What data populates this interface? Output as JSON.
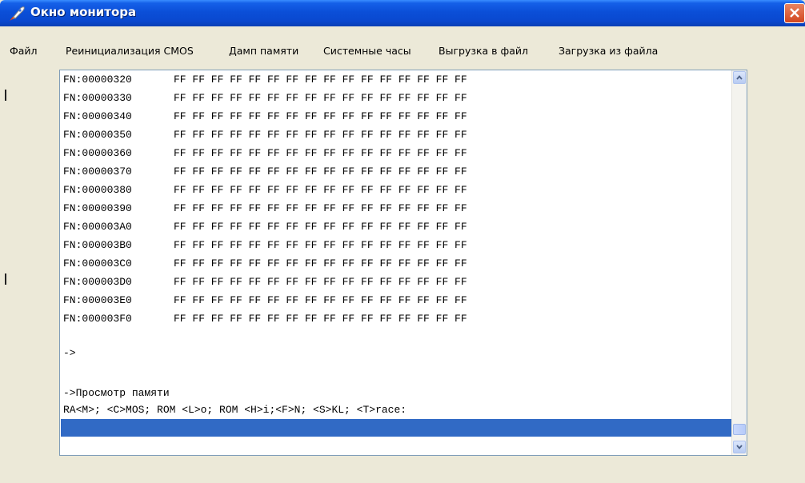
{
  "window": {
    "title": "Окно монитора",
    "icon": "rocket-icon",
    "close_icon": "close-icon"
  },
  "menu": [
    {
      "label": "Файл"
    },
    {
      "label": "Реинициализация CMOS"
    },
    {
      "label": "Дамп памяти"
    },
    {
      "label": "Системные часы"
    },
    {
      "label": "Выгрузка в файл"
    },
    {
      "label": "Загрузка из файла"
    }
  ],
  "dump": [
    {
      "addr": "FN:00000320",
      "bytes": "FF FF FF FF FF FF FF FF FF FF FF FF FF FF FF FF"
    },
    {
      "addr": "FN:00000330",
      "bytes": "FF FF FF FF FF FF FF FF FF FF FF FF FF FF FF FF"
    },
    {
      "addr": "FN:00000340",
      "bytes": "FF FF FF FF FF FF FF FF FF FF FF FF FF FF FF FF"
    },
    {
      "addr": "FN:00000350",
      "bytes": "FF FF FF FF FF FF FF FF FF FF FF FF FF FF FF FF"
    },
    {
      "addr": "FN:00000360",
      "bytes": "FF FF FF FF FF FF FF FF FF FF FF FF FF FF FF FF"
    },
    {
      "addr": "FN:00000370",
      "bytes": "FF FF FF FF FF FF FF FF FF FF FF FF FF FF FF FF"
    },
    {
      "addr": "FN:00000380",
      "bytes": "FF FF FF FF FF FF FF FF FF FF FF FF FF FF FF FF"
    },
    {
      "addr": "FN:00000390",
      "bytes": "FF FF FF FF FF FF FF FF FF FF FF FF FF FF FF FF"
    },
    {
      "addr": "FN:000003A0",
      "bytes": "FF FF FF FF FF FF FF FF FF FF FF FF FF FF FF FF"
    },
    {
      "addr": "FN:000003B0",
      "bytes": "FF FF FF FF FF FF FF FF FF FF FF FF FF FF FF FF"
    },
    {
      "addr": "FN:000003C0",
      "bytes": "FF FF FF FF FF FF FF FF FF FF FF FF FF FF FF FF"
    },
    {
      "addr": "FN:000003D0",
      "bytes": "FF FF FF FF FF FF FF FF FF FF FF FF FF FF FF FF"
    },
    {
      "addr": "FN:000003E0",
      "bytes": "FF FF FF FF FF FF FF FF FF FF FF FF FF FF FF FF"
    },
    {
      "addr": "FN:000003F0",
      "bytes": "FF FF FF FF FF FF FF FF FF FF FF FF FF FF FF FF"
    }
  ],
  "console": {
    "prompt1": "->",
    "prompt2": "->Просмотр памяти",
    "options": "RA<M>; <C>MOS; ROM <L>o; ROM <H>i;<F>N; <S>KL; <T>race:"
  },
  "colors": {
    "titlebar": "#0b4fd8",
    "selection": "#316ac5",
    "close": "#d2461f"
  }
}
